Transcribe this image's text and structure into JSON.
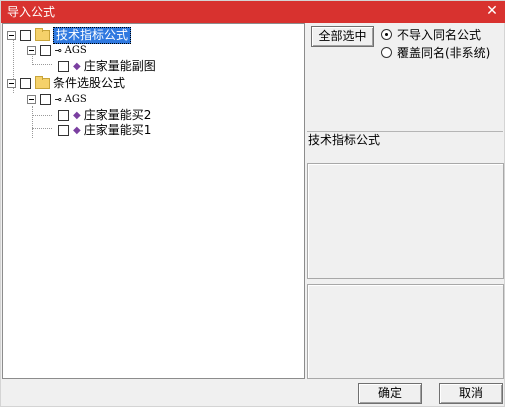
{
  "window": {
    "title": "导入公式",
    "close_glyph": "✕"
  },
  "tree": {
    "nodes": [
      {
        "label": "技术指标公式",
        "type": "folder",
        "selected": true
      },
      {
        "label": "AGS",
        "type": "group"
      },
      {
        "label": "庄家量能副图",
        "type": "formula"
      },
      {
        "label": "条件选股公式",
        "type": "folder"
      },
      {
        "label": "AGS",
        "type": "group"
      },
      {
        "label": "庄家量能买2",
        "type": "formula"
      },
      {
        "label": "庄家量能买1",
        "type": "formula"
      }
    ]
  },
  "right_panel": {
    "select_all_label": "全部选中",
    "radio_no_import_label": "不导入同名公式",
    "radio_overwrite_label": "覆盖同名(非系统)",
    "selected_type_label": "技术指标公式"
  },
  "footer": {
    "ok_label": "确定",
    "cancel_label": "取消"
  }
}
